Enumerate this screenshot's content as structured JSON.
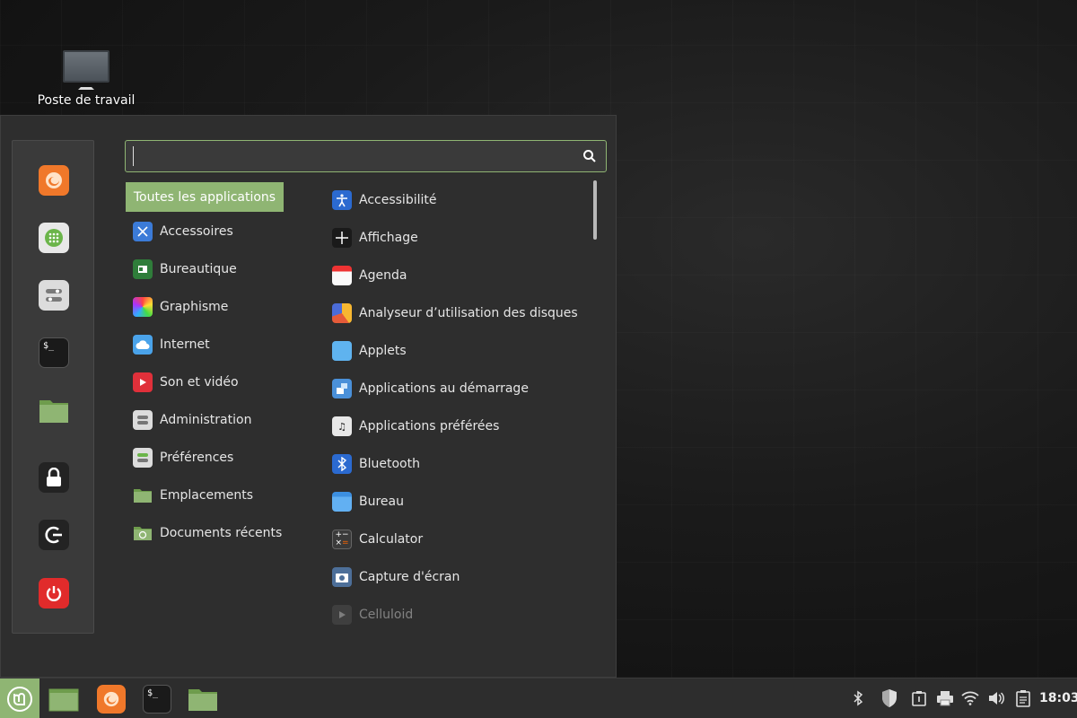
{
  "desktop": {
    "icon_label": "Poste de travail"
  },
  "menu": {
    "search": {
      "value": "",
      "placeholder": ""
    },
    "favorites": [
      "firefox-icon",
      "software-manager-icon",
      "system-settings-icon",
      "terminal-icon",
      "files-icon",
      "lock-screen-icon",
      "logout-icon",
      "power-icon"
    ],
    "categories": {
      "selected": "Toutes les applications",
      "items": [
        {
          "label": "Accessoires",
          "icon": "accessories-icon"
        },
        {
          "label": "Bureautique",
          "icon": "office-icon"
        },
        {
          "label": "Graphisme",
          "icon": "graphics-icon"
        },
        {
          "label": "Internet",
          "icon": "internet-icon"
        },
        {
          "label": "Son et vidéo",
          "icon": "multimedia-icon"
        },
        {
          "label": "Administration",
          "icon": "administration-icon"
        },
        {
          "label": "Préférences",
          "icon": "preferences-icon"
        },
        {
          "label": "Emplacements",
          "icon": "places-folder-icon"
        },
        {
          "label": "Documents récents",
          "icon": "recent-documents-icon"
        }
      ]
    },
    "apps": [
      {
        "label": "Accessibilité",
        "icon": "accessibility-icon"
      },
      {
        "label": "Affichage",
        "icon": "display-icon"
      },
      {
        "label": "Agenda",
        "icon": "calendar-icon"
      },
      {
        "label": "Analyseur d’utilisation des disques",
        "icon": "disk-usage-icon"
      },
      {
        "label": "Applets",
        "icon": "applets-icon"
      },
      {
        "label": "Applications au démarrage",
        "icon": "startup-apps-icon"
      },
      {
        "label": "Applications préférées",
        "icon": "preferred-apps-icon"
      },
      {
        "label": "Bluetooth",
        "icon": "bluetooth-icon"
      },
      {
        "label": "Bureau",
        "icon": "desktop-folder-icon"
      },
      {
        "label": "Calculator",
        "icon": "calculator-icon"
      },
      {
        "label": "Capture d'écran",
        "icon": "screenshot-icon"
      },
      {
        "label": "Celluloid",
        "icon": "celluloid-icon"
      }
    ]
  },
  "taskbar": {
    "clock": "18:03",
    "apps": [
      "files-icon",
      "firefox-icon",
      "terminal-icon",
      "folder-icon"
    ],
    "tray": [
      "bluetooth-icon",
      "update-shield-icon",
      "clipboard-icon",
      "printer-icon",
      "wifi-icon",
      "volume-icon",
      "notes-icon"
    ]
  },
  "colors": {
    "accent": "#8fb573",
    "menu_bg": "#2e2e2e",
    "panel_bg": "#2d2d2d"
  }
}
